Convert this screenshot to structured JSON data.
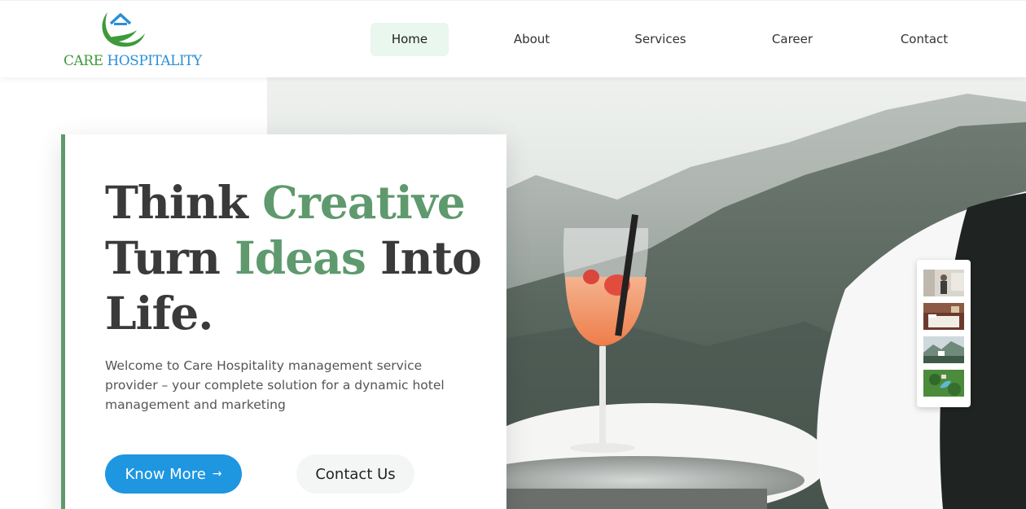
{
  "brand": {
    "logo_care": "CARE",
    "logo_hospitality": "HOSPITALITY",
    "colors": {
      "green": "#3e9a3a",
      "blue": "#2a8fd6"
    }
  },
  "nav": {
    "items": [
      {
        "label": "Home",
        "active": true
      },
      {
        "label": "About",
        "active": false
      },
      {
        "label": "Services",
        "active": false
      },
      {
        "label": "Career",
        "active": false
      },
      {
        "label": "Contact",
        "active": false
      }
    ]
  },
  "hero": {
    "headline": {
      "think": "Think",
      "creative": "Creative",
      "turn": "Turn",
      "ideas": "Ideas",
      "into": "Into",
      "life": "Life."
    },
    "intro": "Welcome to Care Hospitality management service provider – your complete solution for a dynamic hotel management and marketing",
    "primary_button": {
      "label": "Know More",
      "icon": "arrow-right-icon"
    },
    "secondary_button": {
      "label": "Contact Us"
    },
    "accent_colors": {
      "headline_green": "#5e9a6d",
      "primary_button": "#1e96e0"
    }
  },
  "gallery": {
    "thumbnails": [
      {
        "icon": "person-in-room-thumbnail"
      },
      {
        "icon": "hotel-room-thumbnail"
      },
      {
        "icon": "landscape-thumbnail"
      },
      {
        "icon": "aerial-resort-thumbnail"
      }
    ]
  }
}
